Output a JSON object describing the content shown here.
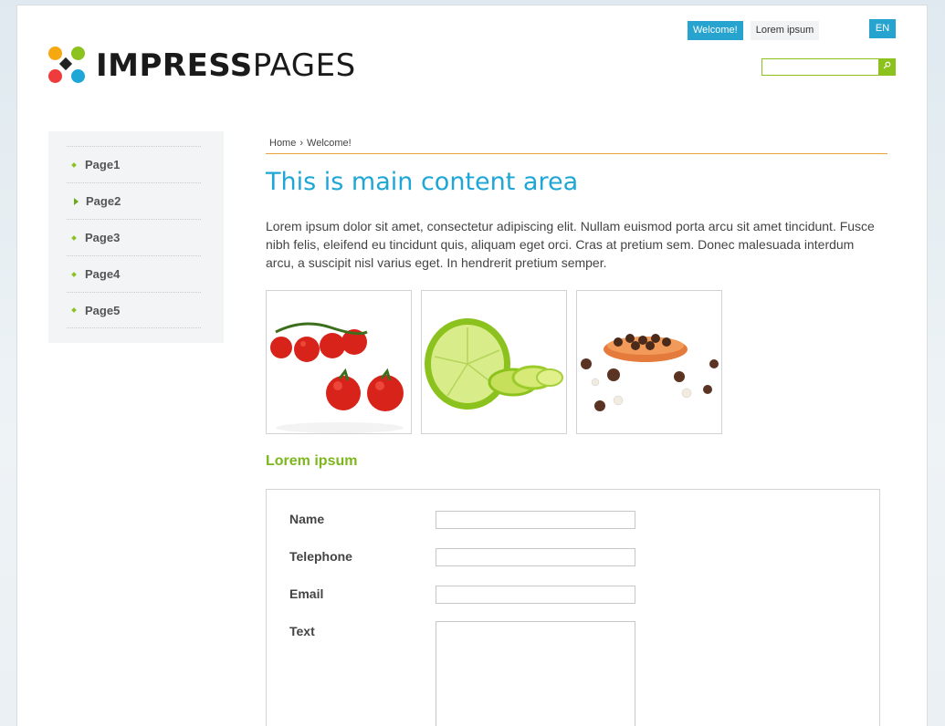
{
  "header": {
    "logo_bold": "IMPRESS",
    "logo_light": "PAGES",
    "topnav": [
      {
        "label": "Welcome!"
      },
      {
        "label": "Lorem ipsum"
      }
    ],
    "language": "EN",
    "search": {
      "value": "",
      "placeholder": ""
    }
  },
  "sidebar": {
    "items": [
      {
        "label": "Page1"
      },
      {
        "label": "Page2"
      },
      {
        "label": "Page3"
      },
      {
        "label": "Page4"
      },
      {
        "label": "Page5"
      }
    ]
  },
  "breadcrumb": {
    "home": "Home",
    "sep": "›",
    "current": "Welcome!"
  },
  "main": {
    "title": "This is main content area",
    "intro": "Lorem ipsum dolor sit amet, consectetur adipiscing elit. Nullam euismod porta arcu sit amet tincidunt. Fusce nibh felis, eleifend eu tincidunt quis, aliquam eget orci. Cras at pretium sem. Donec malesuada interdum arcu, a suscipit nisl varius eget. In hendrerit pretium semper.",
    "gallery": [
      {
        "name": "tomatoes"
      },
      {
        "name": "lime"
      },
      {
        "name": "chocolate-balls"
      }
    ],
    "subtitle": "Lorem ipsum"
  },
  "form": {
    "name_label": "Name",
    "telephone_label": "Telephone",
    "email_label": "Email",
    "text_label": "Text"
  },
  "colors": {
    "accent_blue": "#1ea6d6",
    "accent_green": "#8dc21e",
    "breadcrumb_line": "#e8a33b"
  }
}
